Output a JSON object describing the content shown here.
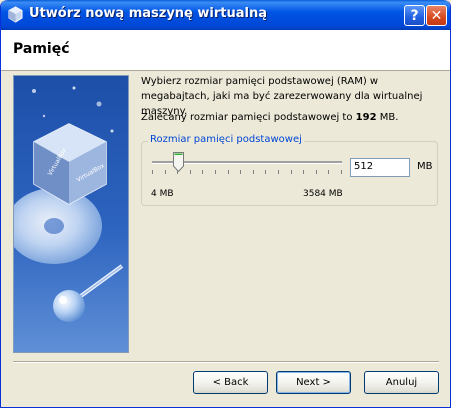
{
  "window": {
    "title": "Utwórz nową maszynę wirtualną",
    "icon": "virtualbox-icon",
    "help_label": "?",
    "close_label": "✕"
  },
  "header": {
    "title": "Pamięć"
  },
  "content": {
    "description": "Wybierz rozmiar pamięci podstawowej (RAM) w megabajtach, jaki ma być zarezerwowany dla wirtualnej maszyny.",
    "recommend_prefix": "Zalecany rozmiar pamięci podstawowej to ",
    "recommend_value": "192",
    "recommend_suffix": " MB.",
    "group_label": "Rozmiar pamięci podstawowej",
    "memory_value": "512",
    "memory_unit": "MB",
    "slider": {
      "min": 4,
      "max": 3584,
      "value": 512,
      "min_label": "4 MB",
      "max_label": "3584 MB"
    }
  },
  "buttons": {
    "back": "< Back",
    "next": "Next >",
    "cancel": "Anuluj"
  },
  "colors": {
    "titlebar": "#0055e5",
    "group_label": "#0046d5",
    "background": "#ece9d8"
  }
}
